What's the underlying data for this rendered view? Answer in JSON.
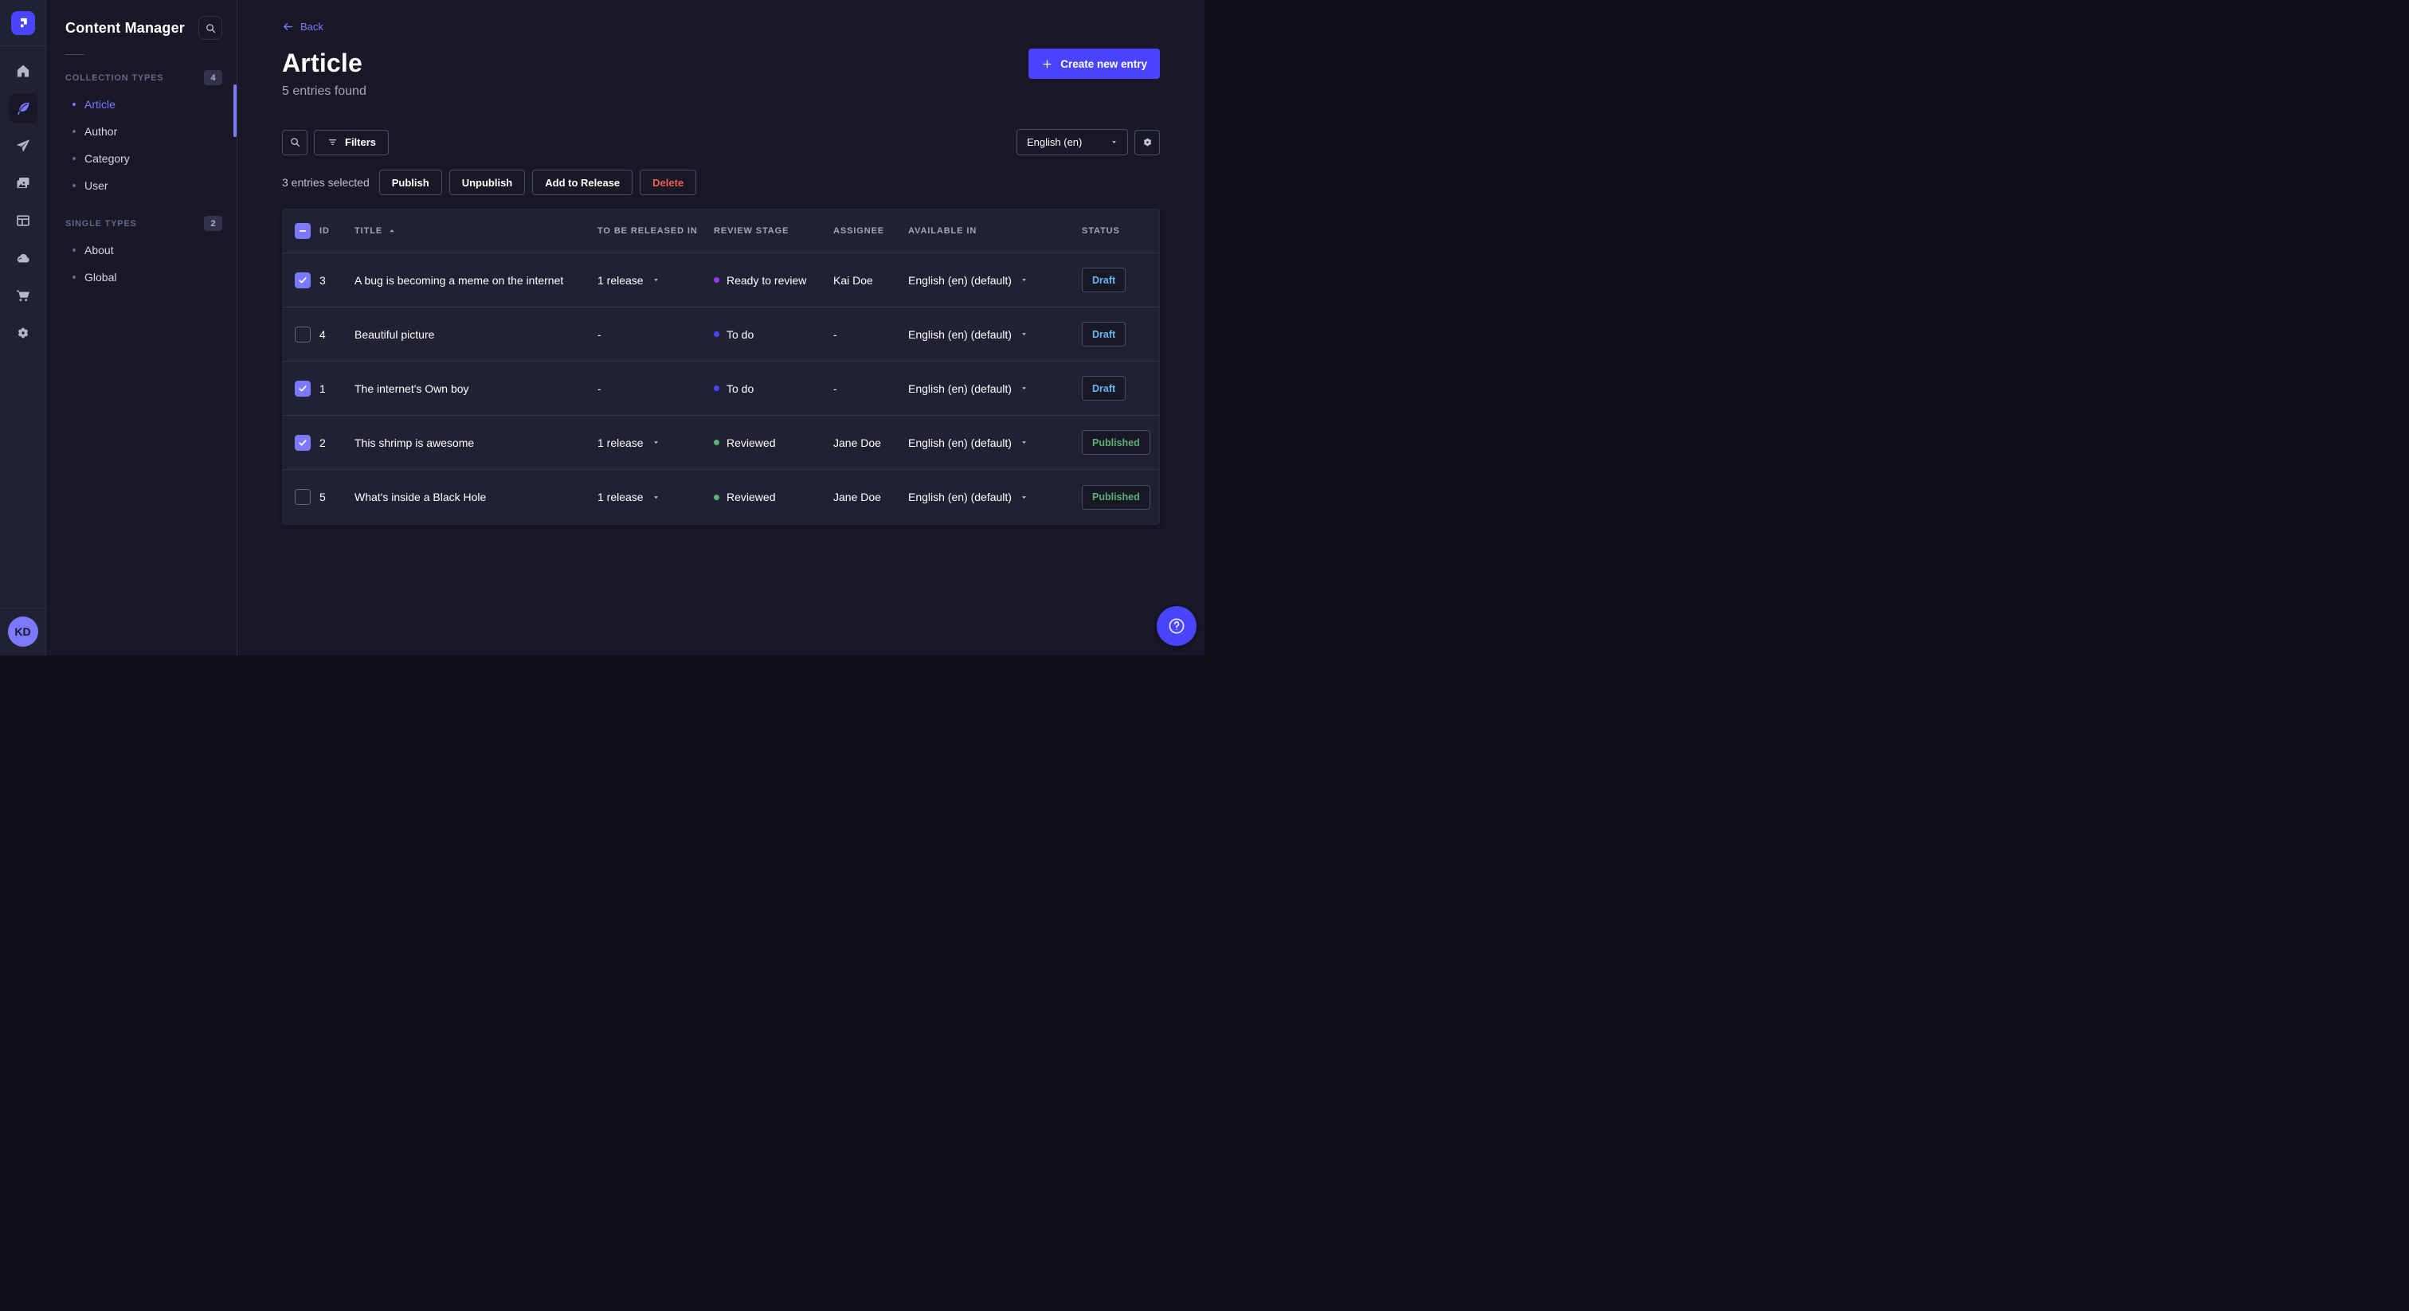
{
  "colors": {
    "accent": "#4945ff",
    "accent_light": "#7b79ff",
    "status_draft": "#66b7f1",
    "status_published": "#5cb176",
    "danger": "#ee5e52"
  },
  "main_nav": {
    "logo_icon": "strapi-logo",
    "items": [
      {
        "icon": "home",
        "active": false
      },
      {
        "icon": "feather",
        "active": true
      },
      {
        "icon": "paper-plane",
        "active": false
      },
      {
        "icon": "media-images",
        "active": false
      },
      {
        "icon": "layout",
        "active": false
      },
      {
        "icon": "cloud",
        "active": false
      },
      {
        "icon": "cart",
        "active": false
      },
      {
        "icon": "gear",
        "active": false
      }
    ],
    "avatar_initials": "KD"
  },
  "subnav": {
    "title": "Content Manager",
    "search_icon": "search-icon",
    "sections": [
      {
        "label": "COLLECTION TYPES",
        "count": "4",
        "items": [
          {
            "label": "Article",
            "active": true
          },
          {
            "label": "Author",
            "active": false
          },
          {
            "label": "Category",
            "active": false
          },
          {
            "label": "User",
            "active": false
          }
        ]
      },
      {
        "label": "SINGLE TYPES",
        "count": "2",
        "items": [
          {
            "label": "About",
            "active": false
          },
          {
            "label": "Global",
            "active": false
          }
        ]
      }
    ]
  },
  "header": {
    "back_label": "Back",
    "title": "Article",
    "subtitle": "5 entries found",
    "create_button_label": "Create new entry"
  },
  "toolbar": {
    "filters_label": "Filters",
    "locale_value": "English (en)"
  },
  "selection": {
    "text": "3 entries selected",
    "actions": [
      {
        "label": "Publish",
        "variant": "default"
      },
      {
        "label": "Unpublish",
        "variant": "default"
      },
      {
        "label": "Add to Release",
        "variant": "default"
      },
      {
        "label": "Delete",
        "variant": "danger"
      }
    ]
  },
  "table": {
    "header_checkbox_state": "indeterminate",
    "columns": [
      "ID",
      "TITLE",
      "TO BE RELEASED IN",
      "REVIEW STAGE",
      "ASSIGNEE",
      "AVAILABLE IN",
      "STATUS"
    ],
    "sorted_column": "TITLE",
    "sort_direction": "ascending",
    "rows": [
      {
        "checked": true,
        "id": "3",
        "title": "A bug is becoming a meme on the internet",
        "release": "1 release",
        "stage": "Ready to review",
        "stage_color": "#9736e8",
        "assignee": "Kai Doe",
        "locale": "English (en) (default)",
        "status": "Draft"
      },
      {
        "checked": false,
        "id": "4",
        "title": "Beautiful picture",
        "release": "-",
        "stage": "To do",
        "stage_color": "#4945ff",
        "assignee": "-",
        "locale": "English (en) (default)",
        "status": "Draft"
      },
      {
        "checked": true,
        "id": "1",
        "title": "The internet's Own boy",
        "release": "-",
        "stage": "To do",
        "stage_color": "#4945ff",
        "assignee": "-",
        "locale": "English (en) (default)",
        "status": "Draft"
      },
      {
        "checked": true,
        "id": "2",
        "title": "This shrimp is awesome",
        "release": "1 release",
        "stage": "Reviewed",
        "stage_color": "#5cb176",
        "assignee": "Jane Doe",
        "locale": "English (en) (default)",
        "status": "Published"
      },
      {
        "checked": false,
        "id": "5",
        "title": "What's inside a Black Hole",
        "release": "1 release",
        "stage": "Reviewed",
        "stage_color": "#5cb176",
        "assignee": "Jane Doe",
        "locale": "English (en) (default)",
        "status": "Published"
      }
    ]
  },
  "help": {
    "icon": "question-circle-icon"
  }
}
